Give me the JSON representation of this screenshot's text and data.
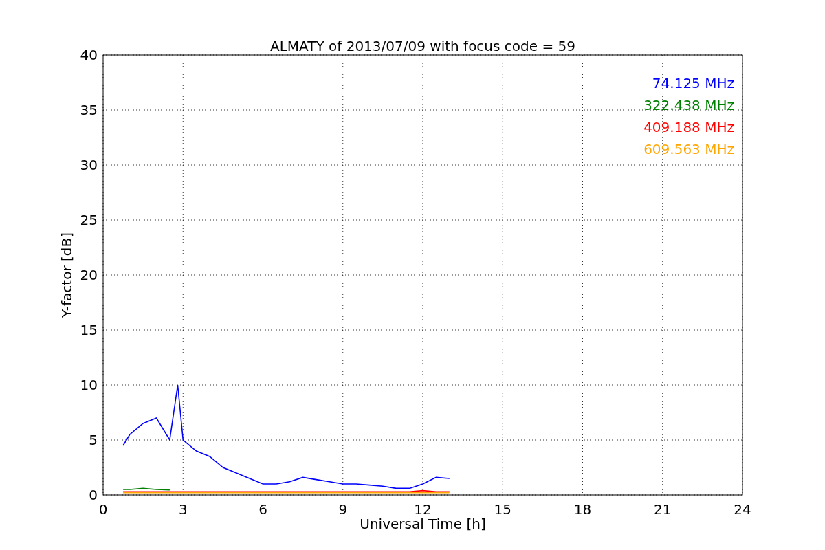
{
  "chart_data": {
    "type": "line",
    "title": "ALMATY of 2013/07/09 with focus code = 59",
    "xlabel": "Universal Time [h]",
    "ylabel": "Y-factor [dB]",
    "grid": true,
    "xlim": [
      0,
      24
    ],
    "ylim": [
      0,
      40
    ],
    "xticks": [
      0,
      3,
      6,
      9,
      12,
      15,
      18,
      21,
      24
    ],
    "yticks": [
      0,
      5,
      10,
      15,
      20,
      25,
      30,
      35,
      40
    ],
    "x": [
      0.75,
      1,
      1.5,
      2,
      2.5,
      2.8,
      3,
      3.5,
      4,
      4.5,
      5,
      5.5,
      6,
      6.5,
      7,
      7.5,
      8,
      8.5,
      9,
      9.5,
      10,
      10.5,
      11,
      11.5,
      12,
      12.5,
      13
    ],
    "series": [
      {
        "name": "74.125 MHz",
        "color": "#0000ff",
        "values": [
          4.5,
          5.5,
          6.5,
          7,
          5,
          10,
          5,
          4,
          3.5,
          2.5,
          2,
          1.5,
          1,
          1,
          1.2,
          1.6,
          1.4,
          1.2,
          1,
          1,
          0.9,
          0.8,
          0.6,
          0.6,
          1,
          1.6,
          1.5
        ]
      },
      {
        "name": "322.438 MHz",
        "color": "#008000",
        "values": [
          0.5,
          0.5,
          0.6,
          0.5,
          0.45,
          null,
          null,
          null,
          null,
          null,
          null,
          null,
          null,
          null,
          null,
          null,
          null,
          null,
          null,
          null,
          null,
          null,
          null,
          null,
          null,
          null,
          null
        ]
      },
      {
        "name": "409.188 MHz",
        "color": "#ff0000",
        "values": [
          0.3,
          0.3,
          0.3,
          0.3,
          0.3,
          0.3,
          0.3,
          0.3,
          0.3,
          0.3,
          0.3,
          0.3,
          0.3,
          0.3,
          0.3,
          0.3,
          0.3,
          0.3,
          0.3,
          0.3,
          0.3,
          0.3,
          0.3,
          0.3,
          0.4,
          0.3,
          0.3
        ]
      },
      {
        "name": "609.563 MHz",
        "color": "#ffa500",
        "values": [
          0.2,
          0.2,
          0.2,
          0.2,
          0.2,
          0.2,
          0.2,
          0.2,
          0.2,
          0.2,
          0.2,
          0.2,
          0.2,
          0.2,
          0.2,
          0.2,
          0.2,
          0.2,
          0.2,
          0.2,
          0.2,
          0.2,
          0.2,
          0.2,
          0.2,
          0.2,
          0.2
        ]
      }
    ]
  }
}
